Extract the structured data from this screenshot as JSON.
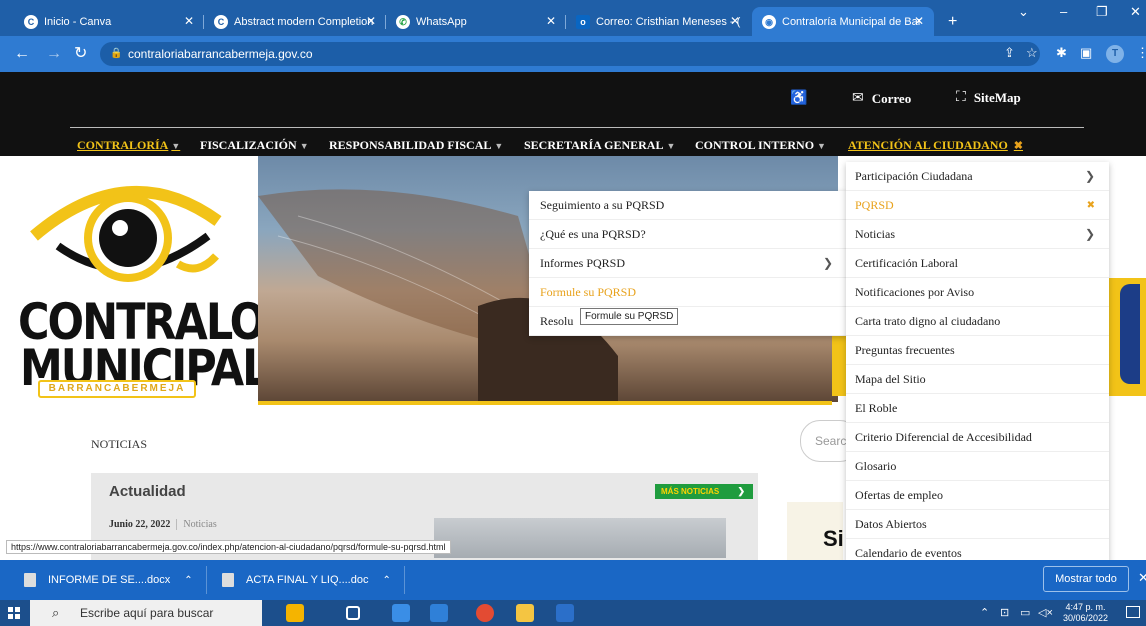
{
  "browser": {
    "tabs": [
      {
        "label": "Inicio - Canva",
        "icon": "canva-icon"
      },
      {
        "label": "Abstract modern Completion",
        "icon": "canva-icon"
      },
      {
        "label": "WhatsApp",
        "icon": "whatsapp-icon"
      },
      {
        "label": "Correo: Cristhian Meneses - (",
        "icon": "outlook-icon"
      },
      {
        "label": "Contraloría Municipal de Bar",
        "icon": "chrome-icon"
      }
    ],
    "new_tab_glyph": "+",
    "url": "contraloriabarrancabermeja.gov.co",
    "profile_initial": "T"
  },
  "site": {
    "utility": {
      "accessibility_icon": "♿",
      "mail_label": "Correo",
      "sitemap_label": "SiteMap"
    },
    "nav": [
      {
        "label": "CONTRALORÍA"
      },
      {
        "label": "FISCALIZACIÓN"
      },
      {
        "label": "RESPONSABILIDAD FISCAL"
      },
      {
        "label": "SECRETARÍA GENERAL"
      },
      {
        "label": "CONTROL INTERNO"
      },
      {
        "label": "ATENCIÓN AL CIUDADANO"
      }
    ],
    "logo": {
      "line1": "CONTRALORÍA",
      "line2": "MUNICIPAL",
      "band": "BARRANCABERMEJA"
    },
    "pqrsd_submenu": [
      {
        "label": "Seguimiento a su PQRSD"
      },
      {
        "label": "¿Qué es una PQRSD?"
      },
      {
        "label": "Informes PQRSD"
      },
      {
        "label": "Formule su PQRSD"
      },
      {
        "label": "Resolu"
      }
    ],
    "tooltip": "Formule su PQRSD",
    "atencion_menu": [
      {
        "label": "Participación Ciudadana"
      },
      {
        "label": "PQRSD"
      },
      {
        "label": "Noticias"
      },
      {
        "label": "Certificación Laboral"
      },
      {
        "label": "Notificaciones por Aviso"
      },
      {
        "label": "Carta trato digno al ciudadano"
      },
      {
        "label": "Preguntas frecuentes"
      },
      {
        "label": "Mapa del Sitio"
      },
      {
        "label": "El Roble"
      },
      {
        "label": "Criterio Diferencial de Accesibilidad"
      },
      {
        "label": "Glosario"
      },
      {
        "label": "Ofertas de empleo"
      },
      {
        "label": "Datos Abiertos"
      },
      {
        "label": "Calendario de eventos"
      }
    ],
    "news": {
      "section_title": "NOTICIAS",
      "box_title": "Actualidad",
      "more_label": "MÁS NOTICIAS",
      "post_date": "Junio 22, 2022",
      "post_category": "Noticias"
    },
    "search_placeholder": "Searc",
    "side_banner_text": "Si"
  },
  "status_url": "https://www.contraloriabarrancabermeja.gov.co/index.php/atencion-al-ciudadano/pqrsd/formule-su-pqrsd.html",
  "downloads": {
    "items": [
      {
        "label": "INFORME DE SE....docx"
      },
      {
        "label": "ACTA FINAL Y LIQ....doc"
      }
    ],
    "show_all": "Mostrar todo"
  },
  "taskbar": {
    "search_placeholder": "Escribe aquí para buscar",
    "time": "4:47 p. m.",
    "date": "30/06/2022"
  },
  "colors": {
    "accent_yellow": "#f2c318",
    "menu_highlight": "#e8a21c",
    "chrome_blue": "#1f5fa8",
    "news_button": "#1f9c3e"
  }
}
